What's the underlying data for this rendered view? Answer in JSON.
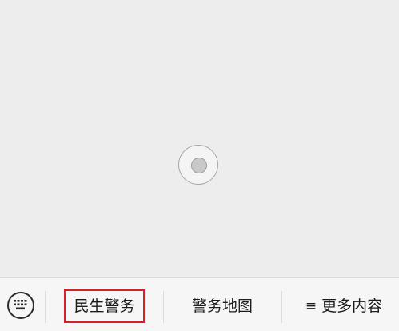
{
  "menu": {
    "items": [
      {
        "label": "民生警务"
      },
      {
        "label": "警务地图"
      },
      {
        "label": "更多内容",
        "icon": "≡"
      }
    ]
  },
  "colors": {
    "highlight": "#d9202a",
    "bar_background": "#f6f6f6",
    "content_background": "#ededed"
  },
  "icons": {
    "keyboard": "keyboard-icon",
    "loading": "loading-spinner",
    "more": "hamburger-menu-icon"
  }
}
